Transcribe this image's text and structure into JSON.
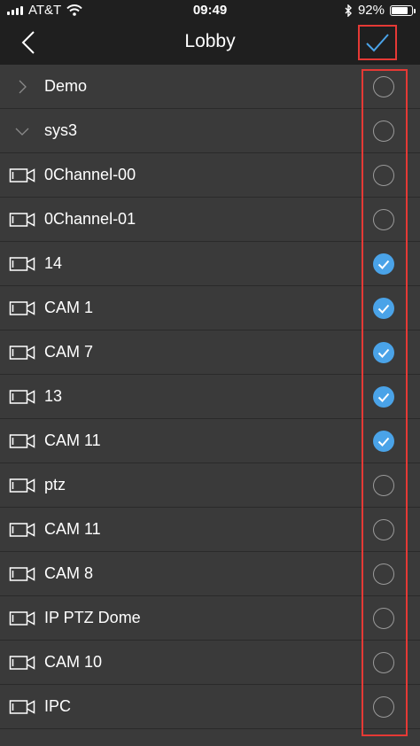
{
  "status_bar": {
    "carrier": "AT&T",
    "time": "09:49",
    "battery_percent": "92%",
    "battery_level": 0.92,
    "icons": [
      "wifi-icon",
      "bluetooth-icon",
      "battery-icon"
    ]
  },
  "nav": {
    "title": "Lobby",
    "back_icon": "chevron-left-icon",
    "confirm_icon": "checkmark-icon"
  },
  "colors": {
    "background": "#3a3a3a",
    "bar": "#1f1f1f",
    "accent": "#4aa3e8",
    "highlight": "#e53935"
  },
  "items": [
    {
      "label": "Demo",
      "type": "group-collapsed",
      "selected": false
    },
    {
      "label": "sys3",
      "type": "group-expanded",
      "selected": false
    },
    {
      "label": "0Channel-00",
      "type": "camera",
      "selected": false
    },
    {
      "label": "0Channel-01",
      "type": "camera",
      "selected": false
    },
    {
      "label": "14",
      "type": "camera",
      "selected": true
    },
    {
      "label": "CAM 1",
      "type": "camera",
      "selected": true
    },
    {
      "label": "CAM 7",
      "type": "camera",
      "selected": true
    },
    {
      "label": "13",
      "type": "camera",
      "selected": true
    },
    {
      "label": "CAM 11",
      "type": "camera",
      "selected": true
    },
    {
      "label": "ptz",
      "type": "camera",
      "selected": false
    },
    {
      "label": "CAM 11",
      "type": "camera",
      "selected": false
    },
    {
      "label": "CAM 8",
      "type": "camera",
      "selected": false
    },
    {
      "label": "IP PTZ Dome",
      "type": "camera",
      "selected": false
    },
    {
      "label": "CAM 10",
      "type": "camera",
      "selected": false
    },
    {
      "label": "IPC",
      "type": "camera",
      "selected": false
    }
  ]
}
